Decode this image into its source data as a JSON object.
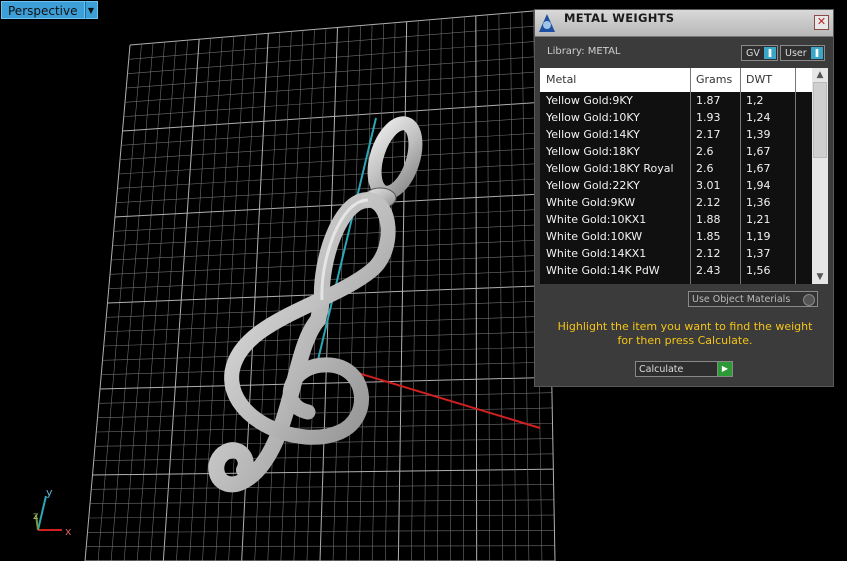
{
  "viewport": {
    "label": "Perspective",
    "axis_labels": {
      "y": "y",
      "z": "z",
      "x": "x"
    }
  },
  "panel": {
    "title": "METAL WEIGHTS",
    "close_symbol": "✕",
    "library_label": "Library: METAL",
    "gv_label": "GV",
    "user_label": "User",
    "columns": [
      "Metal",
      "Grams",
      "DWT"
    ],
    "rows": [
      [
        "Yellow Gold:9KY",
        "1.87",
        "1,2"
      ],
      [
        "Yellow Gold:10KY",
        "1.93",
        "1,24"
      ],
      [
        "Yellow Gold:14KY",
        "2.17",
        "1,39"
      ],
      [
        "Yellow Gold:18KY",
        "2.6",
        "1,67"
      ],
      [
        "Yellow Gold:18KY Royal",
        "2.6",
        "1,67"
      ],
      [
        "Yellow Gold:22KY",
        "3.01",
        "1,94"
      ],
      [
        "White Gold:9KW",
        "2.12",
        "1,36"
      ],
      [
        "White Gold:10KX1",
        "1.88",
        "1,21"
      ],
      [
        "White Gold:10KW",
        "1.85",
        "1,19"
      ],
      [
        "White Gold:14KX1",
        "2.12",
        "1,37"
      ],
      [
        "White Gold:14K PdW",
        "2.43",
        "1,56"
      ]
    ],
    "use_object_materials_label": "Use Object Materials",
    "hint_line1": "Highlight the item you want to find the weight",
    "hint_line2": "for then press Calculate.",
    "calculate_label": "Calculate"
  },
  "colors": {
    "viewport_label_bg": "#3d9fd8",
    "hint_text": "#f5c518",
    "x_axis": "#d02020",
    "y_axis": "#2aa8b8",
    "grid": "#8a8a8a"
  },
  "icons": {
    "viewport_menu": "triangle-down-icon",
    "panel": "metal-weights-icon",
    "close": "close-icon",
    "scroll_up": "triangle-up-icon",
    "scroll_down": "triangle-down-icon",
    "calculate": "play-arrow-icon"
  }
}
